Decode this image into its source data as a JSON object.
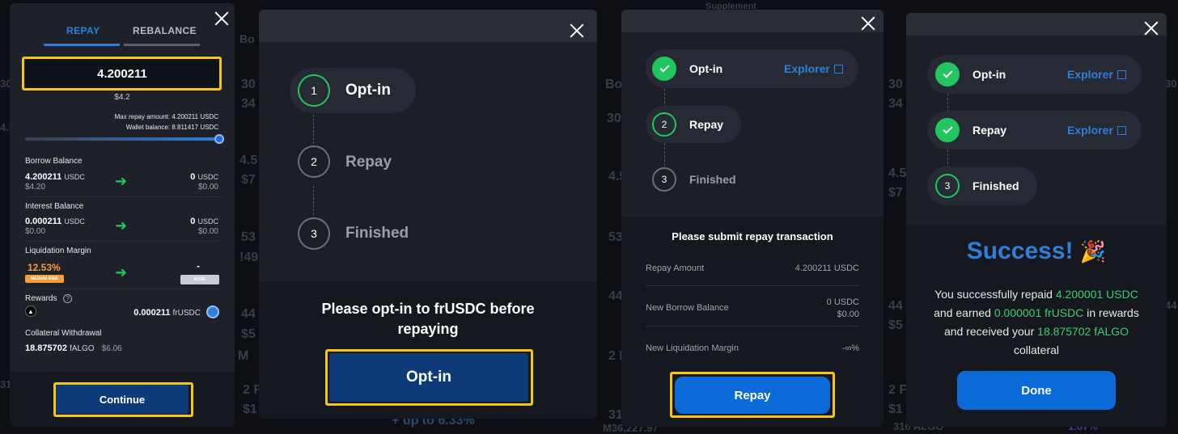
{
  "background": {
    "texts": [
      "Bo",
      "30",
      "34",
      "4.5",
      "$7",
      "53",
      "!49",
      "44",
      "$5",
      "2 F",
      "$1",
      "31",
      "M",
      "+ up to 6.33%",
      "316 ALGO",
      "1.87%",
      "M36,227.97",
      "Supplement"
    ]
  },
  "panel1": {
    "tabs": {
      "repay": "REPAY",
      "rebalance": "REBALANCE"
    },
    "amount_input": "4.200211",
    "amount_usd": "$4.2",
    "max_repay": "Max repay amount: 4.200211 USDC",
    "wallet_balance": "Wallet balance: 8.811417 USDC",
    "slider_fraction": 1.0,
    "borrow": {
      "label": "Borrow Balance",
      "from_val": "4.200211",
      "from_unit": "USDC",
      "from_usd": "$4.20",
      "to_val": "0",
      "to_unit": "USDC",
      "to_usd": "$0.00"
    },
    "interest": {
      "label": "Interest Balance",
      "from_val": "0.000211",
      "from_unit": "USDC",
      "from_usd": "$0.00",
      "to_val": "0",
      "to_unit": "USDC",
      "to_usd": "$0.00"
    },
    "liquidation": {
      "label": "Liquidation Margin",
      "from_val": "12.53%",
      "from_badge": "MEDIUM RISK",
      "to_val": "-",
      "to_badge": "NONE"
    },
    "rewards": {
      "label": "Rewards",
      "help": "?",
      "value": "0.000211",
      "unit": "frUSDC"
    },
    "collateral": {
      "label": "Collateral Withdrawal",
      "value": "18.875702",
      "unit": "fALGO",
      "usd": "$6.06"
    },
    "continue_label": "Continue"
  },
  "panel2": {
    "steps": [
      {
        "num": "1",
        "label": "Opt-in"
      },
      {
        "num": "2",
        "label": "Repay"
      },
      {
        "num": "3",
        "label": "Finished"
      }
    ],
    "message": "Please opt-in to frUSDC before repaying",
    "button_label": "Opt-in"
  },
  "panel3": {
    "steps": [
      {
        "num": "✓",
        "label": "Opt-in",
        "explorer": "Explorer"
      },
      {
        "num": "2",
        "label": "Repay"
      },
      {
        "num": "3",
        "label": "Finished"
      }
    ],
    "title": "Please submit repay transaction",
    "rows": [
      {
        "label": "Repay Amount",
        "value": "4.200211 USDC",
        "sub": ""
      },
      {
        "label": "New Borrow Balance",
        "value": "0 USDC",
        "sub": "$0.00"
      },
      {
        "label": "New Liquidation Margin",
        "value": "-∞%",
        "sub": ""
      }
    ],
    "button_label": "Repay"
  },
  "panel4": {
    "steps": [
      {
        "num": "✓",
        "label": "Opt-in",
        "explorer": "Explorer"
      },
      {
        "num": "✓",
        "label": "Repay",
        "explorer": "Explorer"
      },
      {
        "num": "3",
        "label": "Finished"
      }
    ],
    "success_title": "Success!",
    "emoji": "🎉",
    "msg_1": "You successfully repaid",
    "repaid": "4.200001 USDC",
    "msg_2": "and earned",
    "earned": "0.000001 frUSDC",
    "msg_3": "in rewards",
    "msg_4": "and received your",
    "received": "18.875702 fALGO",
    "msg_5": "collateral",
    "done_label": "Done"
  },
  "colors": {
    "accent": "#0a6ad8",
    "success": "#22c55e",
    "highlight": "#f5c518",
    "risk": "#f59e3b",
    "link_green": "#3ecf6e"
  }
}
